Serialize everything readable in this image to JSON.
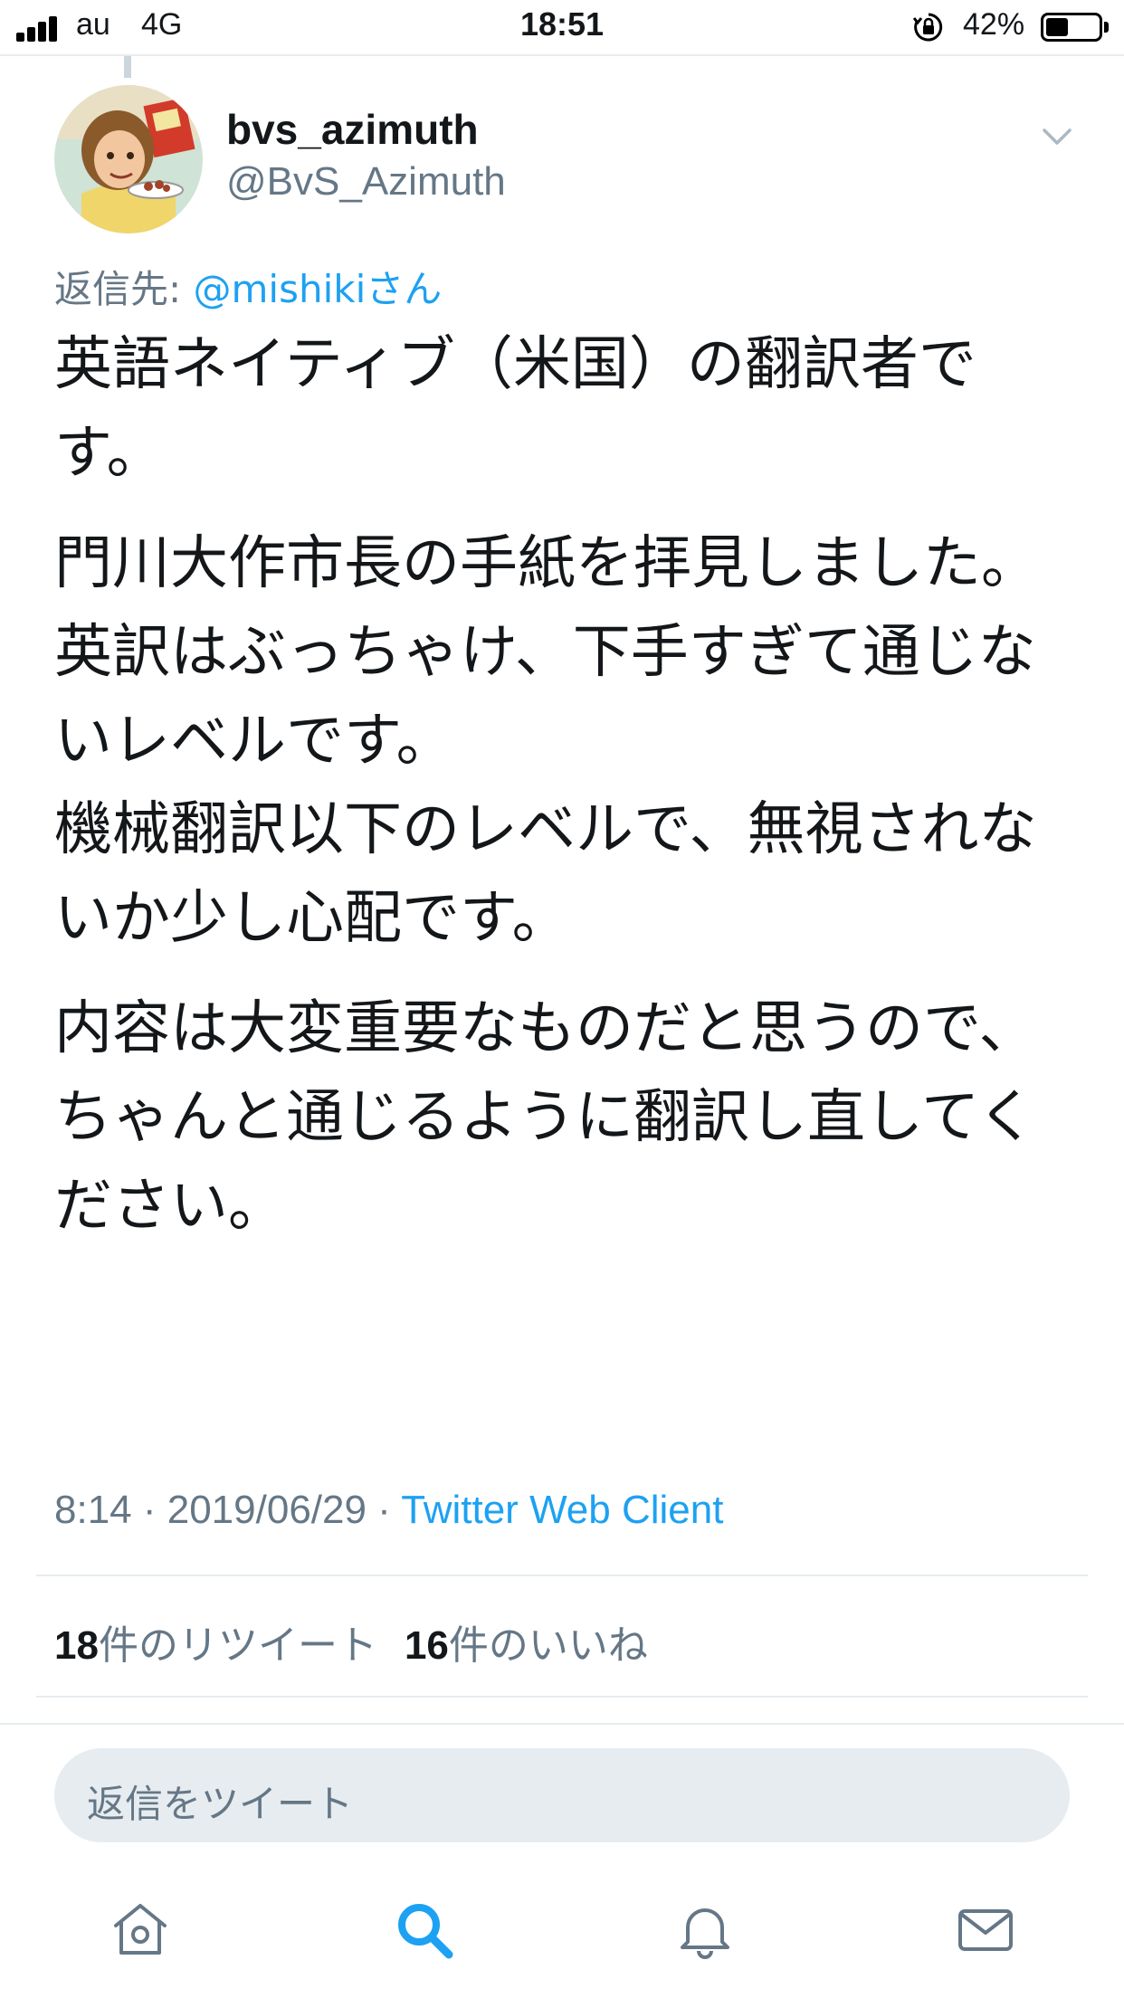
{
  "status_bar": {
    "carrier": "au",
    "network": "4G",
    "time": "18:51",
    "battery_percent": "42%",
    "battery_level": 0.42,
    "icons": [
      "signal-icon",
      "orientation-lock-icon",
      "battery-icon"
    ]
  },
  "tweet": {
    "display_name": "bvs_azimuth",
    "handle": "@BvS_Azimuth",
    "reply_prefix": "返信先: ",
    "reply_mention": "@mishikiさん",
    "paragraphs": [
      "英語ネイティブ（米国）の翻訳者です。",
      "門川大作市長の手紙を拝見しました。\n英訳はぶっちゃけ、下手すぎて通じないレベルです。\n機械翻訳以下のレベルで、無視されないか少し心配です。",
      "内容は大変重要なものだと思うので、\nちゃんと通じるように翻訳し直してください。"
    ],
    "timestamp": "8:14 · 2019/06/29 · ",
    "client": "Twitter Web Client",
    "retweet_count": "18",
    "retweet_label": "件のリツイート",
    "like_count": "16",
    "like_label": "件のいいね"
  },
  "reply_box": {
    "placeholder": "返信をツイート"
  },
  "tab_bar": {
    "items": [
      "home-icon",
      "search-icon",
      "notifications-icon",
      "messages-icon"
    ],
    "active": "search-icon",
    "active_color": "#1da1f2",
    "inactive_color": "#657786"
  }
}
